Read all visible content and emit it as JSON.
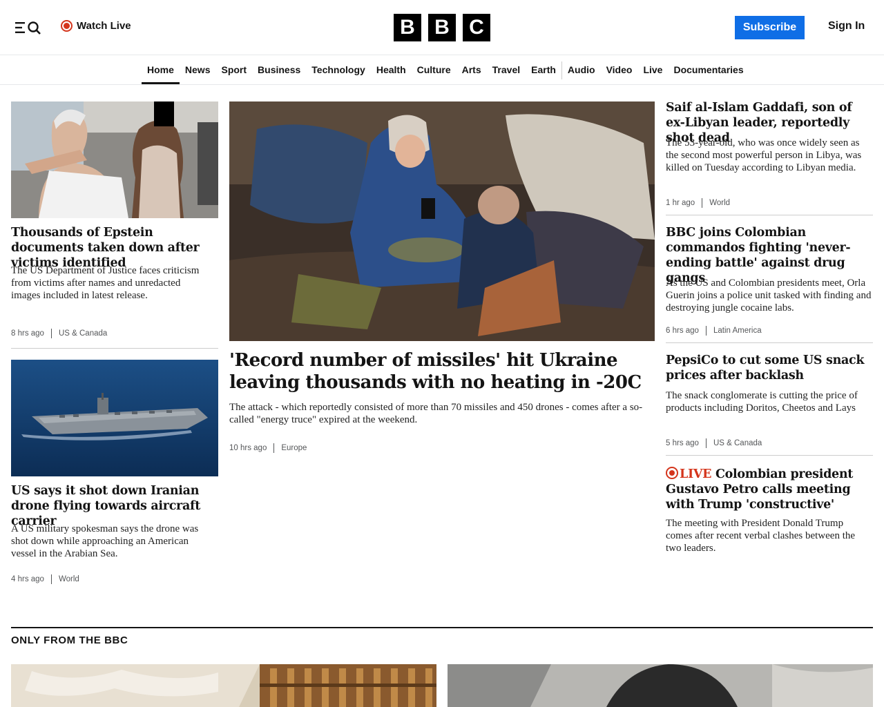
{
  "header": {
    "watch_live": "Watch Live",
    "logo_letters": [
      "B",
      "B",
      "C"
    ],
    "subscribe": "Subscribe",
    "sign_in": "Sign In"
  },
  "nav": {
    "items": [
      "Home",
      "News",
      "Sport",
      "Business",
      "Technology",
      "Health",
      "Culture",
      "Arts",
      "Travel",
      "Earth",
      "Audio",
      "Video",
      "Live",
      "Documentaries"
    ],
    "active": "Home"
  },
  "left_column": [
    {
      "headline": "Thousands of Epstein documents taken down after victims identified",
      "summary": "The US Department of Justice faces criticism from victims after names and unredacted images included in latest release.",
      "time": "8 hrs ago",
      "tag": "US & Canada"
    },
    {
      "headline": "US says it shot down Iranian drone flying towards aircraft carrier",
      "summary": "A US military spokesman says the drone was shot down while approaching an American vessel in the Arabian Sea.",
      "time": "4 hrs ago",
      "tag": "World"
    }
  ],
  "lead": {
    "headline": "'Record number of missiles' hit Ukraine leaving thousands with no heating in -20C",
    "summary": "The attack - which reportedly consisted of more than 70 missiles and 450 drones - comes after a so-called \"energy truce\" expired at the weekend.",
    "time": "10 hrs ago",
    "tag": "Europe"
  },
  "right_column": [
    {
      "headline": "Saif al-Islam Gaddafi, son of ex-Libyan leader, reportedly shot dead",
      "summary": "The 53-year-old, who was once widely seen as the second most powerful person in Libya, was killed on Tuesday according to Libyan media.",
      "time": "1 hr ago",
      "tag": "World"
    },
    {
      "headline": "BBC joins Colombian commandos fighting 'never-ending battle' against drug gangs",
      "summary": "As the US and Colombian presidents meet, Orla Guerin joins a police unit tasked with finding and destroying jungle cocaine labs.",
      "time": "6 hrs ago",
      "tag": "Latin America"
    },
    {
      "headline": "PepsiCo to cut some US snack prices after backlash",
      "summary": "The snack conglomerate is cutting the price of products including Doritos, Cheetos and Lays",
      "time": "5 hrs ago",
      "tag": "US & Canada"
    },
    {
      "live_label": "LIVE",
      "headline": "Colombian president Gustavo Petro calls meeting with Trump 'constructive'",
      "summary": "The meeting with President Donald Trump comes after recent verbal clashes between the two leaders."
    }
  ],
  "section": {
    "title": "ONLY FROM THE BBC"
  },
  "colors": {
    "accent_blue": "#0f6ee6",
    "live_red": "#d4351c",
    "text": "#141414"
  }
}
